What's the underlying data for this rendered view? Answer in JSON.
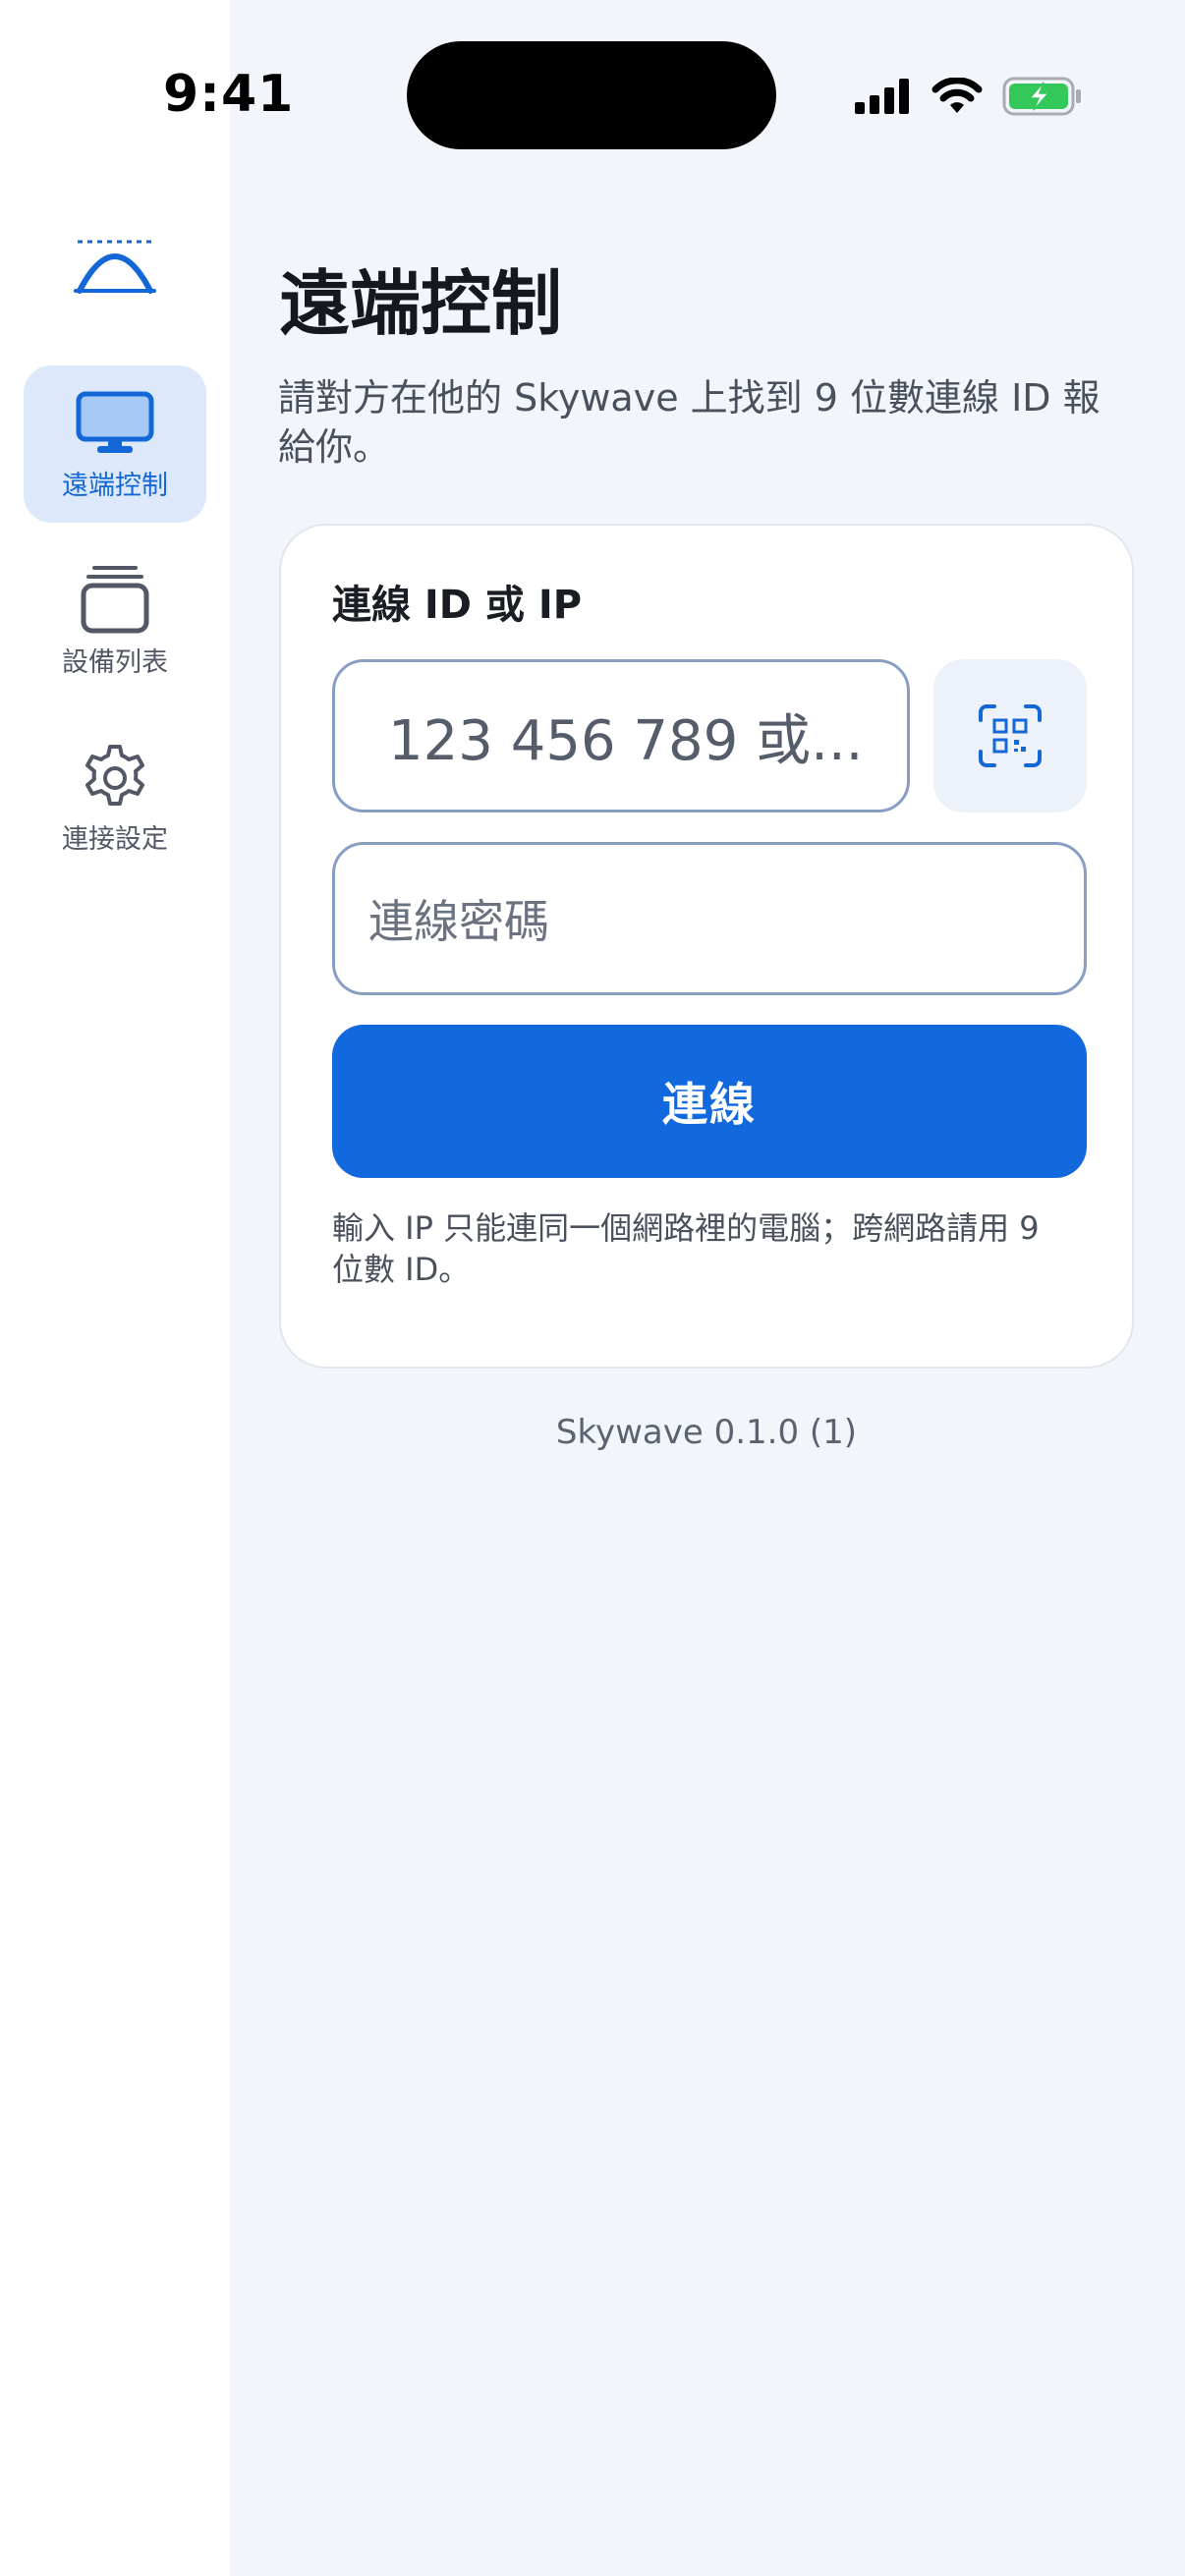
{
  "status_bar": {
    "time": "9:41"
  },
  "sidebar": {
    "logo_icon": "skywave-logo-icon",
    "items": [
      {
        "label": "遠端控制",
        "icon": "monitor-icon",
        "active": true
      },
      {
        "label": "設備列表",
        "icon": "device-stack-icon",
        "active": false
      },
      {
        "label": "連接設定",
        "icon": "gear-icon",
        "active": false
      }
    ]
  },
  "main": {
    "title": "遠端控制",
    "description": "請對方在他的 Skywave 上找到 9 位數連線 ID 報給你。",
    "card": {
      "field_label": "連線 ID 或 IP",
      "id_input_placeholder": "123 456 789 或...",
      "qr_icon": "qr-scan-icon",
      "password_placeholder": "連線密碼",
      "connect_label": "連線",
      "hint": "輸入 IP 只能連同一個網路裡的電腦；跨網路請用 9 位數 ID。"
    },
    "version": "Skywave 0.1.0 (1)"
  },
  "colors": {
    "accent": "#1269dd",
    "sidebar_active_bg": "#dde9fb",
    "page_bg": "#f2f5fa",
    "battery_green": "#34c759"
  }
}
